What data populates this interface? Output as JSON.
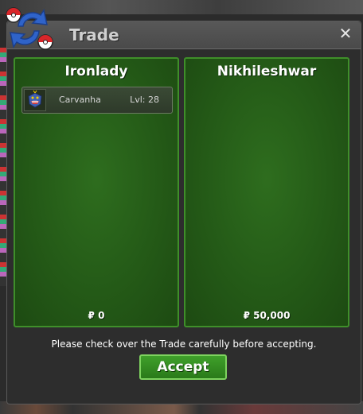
{
  "window": {
    "title": "Trade",
    "close_symbol": "✕"
  },
  "left_panel": {
    "player_name": "Ironlady",
    "items": [
      {
        "name": "Carvanha",
        "level": "Lvl: 28"
      }
    ],
    "money": "₽ 0"
  },
  "right_panel": {
    "player_name": "Nikhileshwar",
    "money": "₽ 50,000"
  },
  "footer": {
    "notice": "Please check over the Trade carefully before accepting.",
    "accept_label": "Accept"
  }
}
